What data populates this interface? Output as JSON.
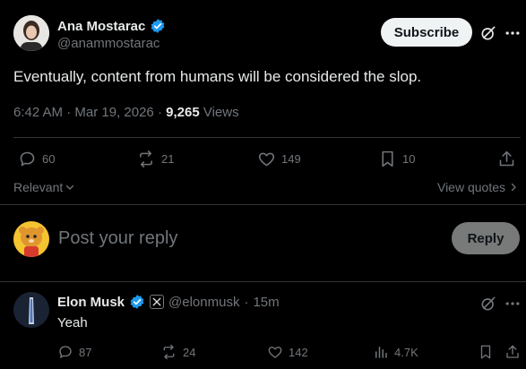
{
  "tweet": {
    "author_name": "Ana Mostarac",
    "author_handle": "@anammostarac",
    "subscribe_label": "Subscribe",
    "text": "Eventually, content from humans will be considered the slop.",
    "time": "6:42 AM",
    "date": "Mar 19, 2026",
    "views_count": "9,265",
    "views_label": "Views",
    "stats": {
      "replies": "60",
      "reposts": "21",
      "likes": "149",
      "bookmarks": "10"
    },
    "relevant_label": "Relevant",
    "view_quotes_label": "View quotes"
  },
  "composer": {
    "placeholder": "Post your reply",
    "reply_label": "Reply"
  },
  "reply": {
    "author_name": "Elon Musk",
    "author_handle": "@elonmusk",
    "time_ago": "15m",
    "text": "Yeah",
    "stats": {
      "replies": "87",
      "reposts": "24",
      "likes": "142",
      "views": "4.7K"
    }
  },
  "colors": {
    "verified": "#1d9bf0",
    "background": "#000000",
    "muted": "#71767b"
  }
}
